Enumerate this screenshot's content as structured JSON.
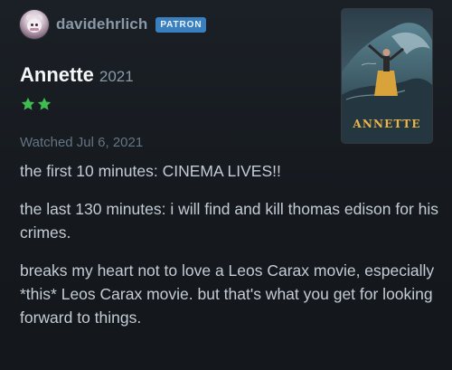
{
  "author": {
    "username": "davidehrlich",
    "badge": "PATRON"
  },
  "film": {
    "title": "Annette",
    "year": "2021",
    "poster_title": "ANNETTE"
  },
  "rating": {
    "stars": 2,
    "max": 5,
    "color": "#40bc50"
  },
  "watched": "Watched Jul 6, 2021",
  "review": {
    "paragraphs": [
      "the first 10 minutes: CINEMA LIVES!!",
      "the last 130 minutes: i will find and kill thomas edison for his crimes.",
      "breaks my heart not to love a Leos Carax movie, especially *this* Leos Carax movie. but that's what you get for looking forward to things."
    ]
  },
  "colors": {
    "background": "#14181c",
    "badge": "#3a7fbe",
    "username": "#8a99a8",
    "title": "#f4f6f8",
    "text": "#c3ccd5",
    "muted": "#667483",
    "poster_title": "#e9b54a"
  }
}
